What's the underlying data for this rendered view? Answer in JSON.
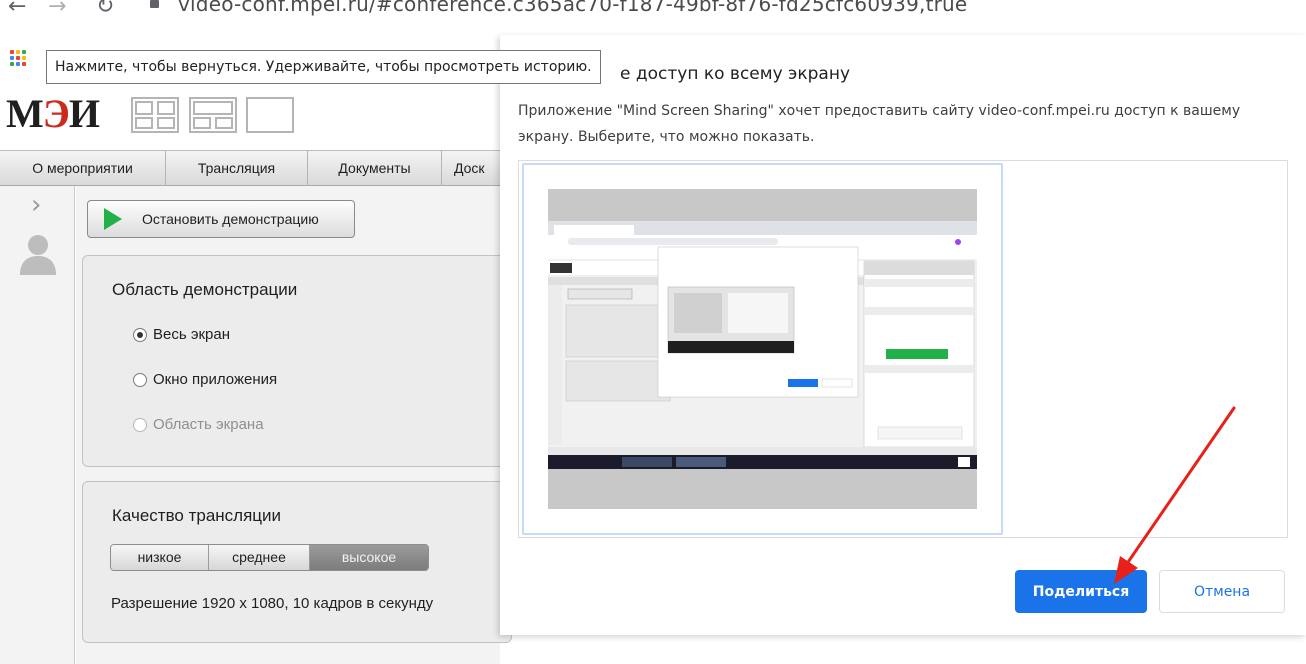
{
  "browser": {
    "url": "video-conf.mpei.ru/#conference.c365ac70-f187-49bf-8f76-fd25cfc60939,true",
    "back_tooltip": "Нажмите, чтобы вернуться. Удерживайте, чтобы просмотреть историю."
  },
  "app": {
    "logo_text": "М",
    "logo_accent": "Э",
    "logo_tail": "И",
    "tabs": [
      {
        "label": "О мероприятии"
      },
      {
        "label": "Трансляция"
      },
      {
        "label": "Документы"
      },
      {
        "label": "Доск"
      }
    ],
    "stop_button_label": "Остановить демонстрацию",
    "demo_area": {
      "title": "Область демонстрации",
      "options": [
        {
          "label": "Весь экран",
          "selected": true,
          "enabled": true
        },
        {
          "label": "Окно приложения",
          "selected": false,
          "enabled": true
        },
        {
          "label": "Область экрана",
          "selected": false,
          "enabled": false
        }
      ]
    },
    "quality": {
      "title": "Качество трансляции",
      "levels": [
        {
          "label": "низкое",
          "active": false
        },
        {
          "label": "среднее",
          "active": false
        },
        {
          "label": "высокое",
          "active": true
        }
      ],
      "resolution_text": "Разрешение 1920 x 1080, 10 кадров в секунду"
    }
  },
  "dialog": {
    "title": "е доступ ко всему экрану",
    "description": "Приложение \"Mind Screen Sharing\" хочет предоставить сайту video-conf.mpei.ru доступ к вашему экрану. Выберите, что можно показать.",
    "share_label": "Поделиться",
    "cancel_label": "Отмена"
  },
  "colors": {
    "accent_blue": "#1a73e8",
    "play_green": "#22b148",
    "logo_red": "#cc2a1d",
    "arrow_red": "#e8201a"
  }
}
